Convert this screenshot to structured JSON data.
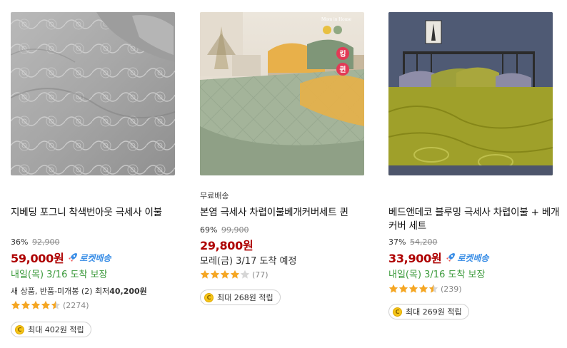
{
  "products": [
    {
      "title": "지베딩 포그니 착색번아웃 극세사 이불",
      "discount": "36%",
      "original_price": "92,900",
      "price": "59,000원",
      "rocket_label": "로켓배송",
      "delivery": "내일(목) 3/16 도착 보장",
      "extra_prefix": "새 상품, 반품-미개봉 (2) 최저",
      "extra_price": "40,200원",
      "rating": 4.5,
      "review_count": "(2274)",
      "reward": "최대 402원 적립",
      "image_icon": "gray-quilted-comforter-image"
    },
    {
      "tag": "무료배송",
      "title": "본염 극세사 차렵이불베개커버세트 퀸",
      "discount": "69%",
      "original_price": "99,900",
      "price": "29,800원",
      "delivery": "모레(금) 3/17 도착 예정",
      "rating": 4,
      "review_count": "(77)",
      "reward": "최대 268원 적립",
      "image_icon": "green-comforter-bedroom-image",
      "image_brand": "Mom in House",
      "image_badges": [
        "킹",
        "퀸"
      ]
    },
    {
      "title": "베드앤데코 블루밍 극세사 차렵이불 + 베개커버 세트",
      "discount": "37%",
      "original_price": "54,200",
      "price": "33,900원",
      "rocket_label": "로켓배송",
      "delivery": "내일(목) 3/16 도착 보장",
      "rating": 4.5,
      "review_count": "(239)",
      "reward": "최대 269원 적립",
      "image_icon": "olive-comforter-bedroom-image"
    }
  ],
  "colors": {
    "price": "#ae0000",
    "delivery_green": "#3c9a3c",
    "rocket_blue": "#3a8ee6",
    "star": "#f5a623"
  }
}
